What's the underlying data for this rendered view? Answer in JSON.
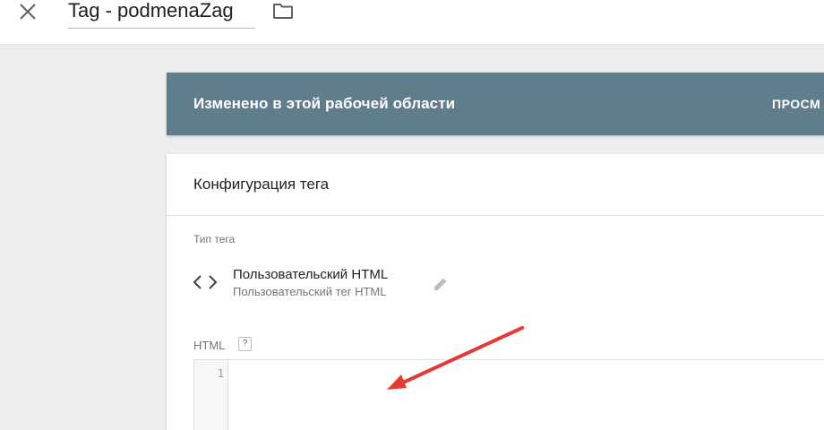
{
  "header": {
    "title": "Tag - podmenaZag",
    "close_icon": "close-icon",
    "folder_icon": "folder-icon"
  },
  "banner": {
    "text": "Изменено в этой рабочей области",
    "action": "ПРОСМ",
    "color": "#607d8b"
  },
  "config": {
    "title": "Конфигурация тега",
    "type_label": "Тип тега",
    "tag_type": {
      "name": "Пользовательский HTML",
      "description": "Пользовательский тег HTML",
      "icon": "code-icon",
      "edit_icon": "pencil-icon"
    },
    "html_label": "HTML",
    "help_label": "?",
    "editor": {
      "line_numbers": [
        "1"
      ],
      "content": ""
    }
  },
  "annotation": {
    "arrow_color": "#e53935"
  }
}
